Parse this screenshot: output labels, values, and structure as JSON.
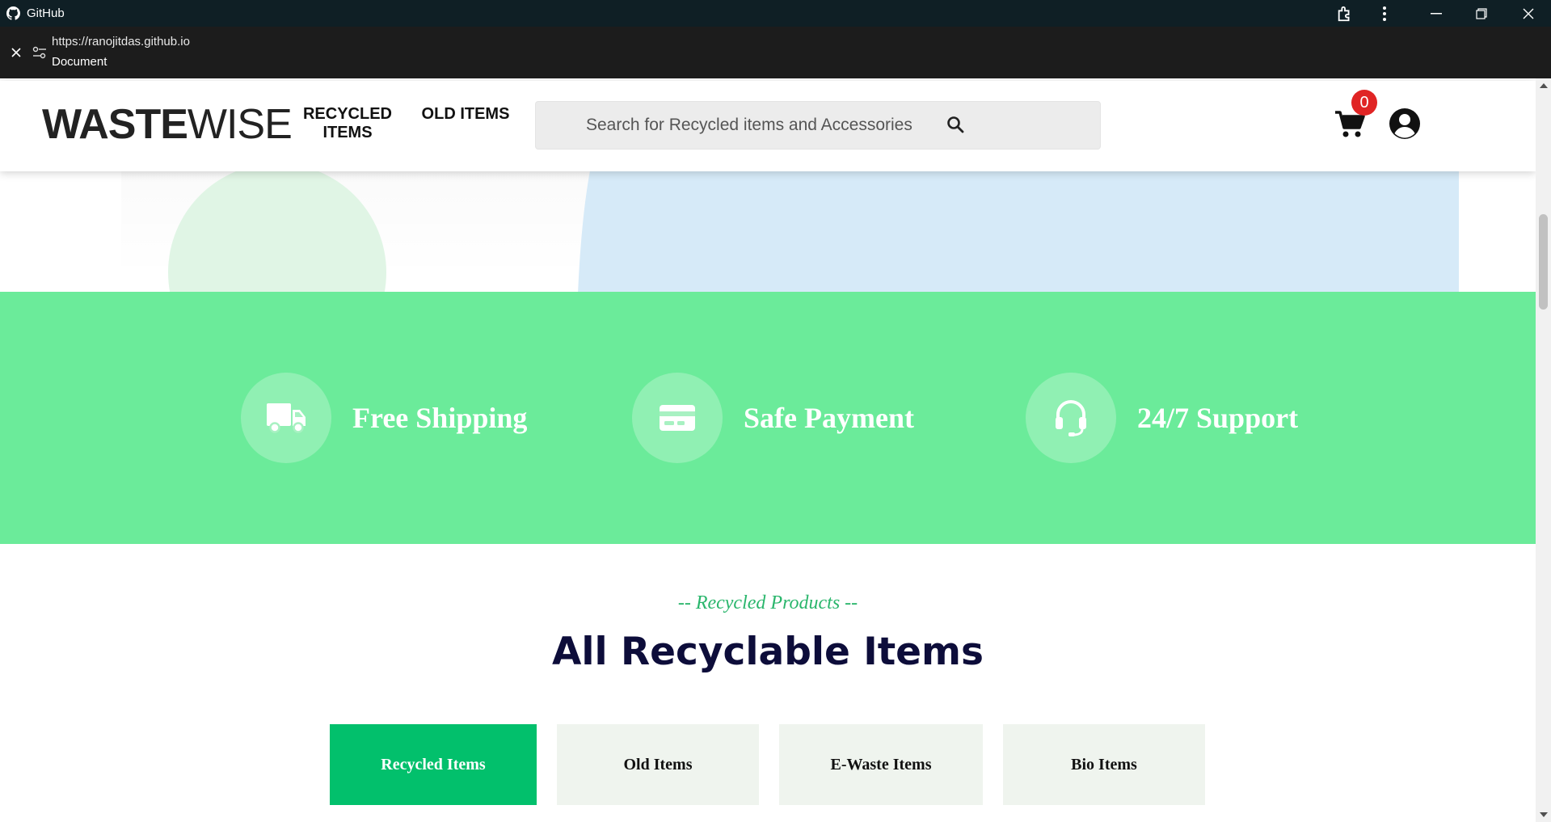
{
  "browser": {
    "app_name": "GitHub",
    "url": "https://ranojitdas.github.io",
    "document_title": "Document"
  },
  "header": {
    "logo_bold": "WASTE",
    "logo_light": "WISE",
    "nav": [
      {
        "label_line1": "RECYCLED",
        "label_line2": "ITEMS"
      },
      {
        "label_line1": "OLD ITEMS",
        "label_line2": ""
      }
    ],
    "search_placeholder": "Search for Recycled items and Accessories",
    "cart_count": "0"
  },
  "features": [
    {
      "icon": "truck-icon",
      "label": "Free Shipping"
    },
    {
      "icon": "credit-card-icon",
      "label": "Safe Payment"
    },
    {
      "icon": "headset-icon",
      "label": "24/7 Support"
    }
  ],
  "products": {
    "subtitle": "-- Recycled Products --",
    "title": "All Recyclable Items",
    "tabs": [
      {
        "label": "Recycled Items",
        "active": true
      },
      {
        "label": "Old Items",
        "active": false
      },
      {
        "label": "E-Waste Items",
        "active": false
      },
      {
        "label": "Bio Items",
        "active": false
      }
    ]
  },
  "colors": {
    "feature_band": "#6beb9a",
    "active_tab": "#02c06c",
    "accent_text": "#2ab66c",
    "title_text": "#0d0d3a",
    "badge": "#e02424"
  }
}
